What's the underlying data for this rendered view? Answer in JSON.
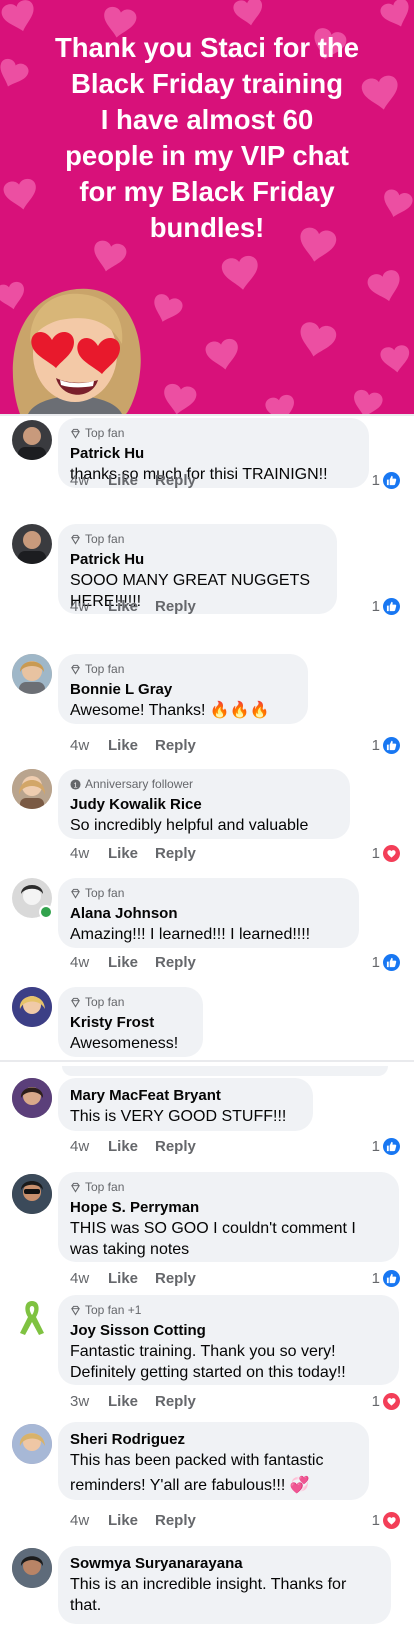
{
  "banner": {
    "lines": [
      "Thank you Staci for the",
      "Black Friday training",
      "I have almost 60",
      "people in my VIP chat",
      "for my Black Friday",
      "bundles!"
    ],
    "bg_color": "#d8117a"
  },
  "comments": [
    {
      "badge": "Top fan",
      "badge_icon": "diamond-icon",
      "name": "Patrick Hu",
      "text": [
        "thanks so much for thisi TRAINIGN!!"
      ],
      "time": "4w",
      "like": "Like",
      "reply": "Reply",
      "count": "1",
      "reaction": "like"
    },
    {
      "badge": "Top fan",
      "badge_icon": "diamond-icon",
      "name": "Patrick Hu",
      "text": [
        "SOOO MANY GREAT NUGGETS",
        "HERE!!!!!!"
      ],
      "time": "4w",
      "like": "Like",
      "reply": "Reply",
      "count": "1",
      "reaction": "like"
    },
    {
      "badge": "Top fan",
      "badge_icon": "diamond-icon",
      "name": "Bonnie L Gray",
      "text": [
        "Awesome!  Thanks! 🔥🔥🔥"
      ],
      "time": "4w",
      "like": "Like",
      "reply": "Reply",
      "count": "1",
      "reaction": "like"
    },
    {
      "badge": "Anniversary follower",
      "badge_icon": "anniversary-icon",
      "name": "Judy Kowalik Rice",
      "text": [
        "So incredibly helpful and valuable"
      ],
      "time": "4w",
      "like": "Like",
      "reply": "Reply",
      "count": "1",
      "reaction": "love"
    },
    {
      "badge": "Top fan",
      "badge_icon": "diamond-icon",
      "name": "Alana Johnson",
      "text": [
        "Amazing!!!  I learned!!!  I learned!!!!"
      ],
      "time": "4w",
      "like": "Like",
      "reply": "Reply",
      "count": "1",
      "reaction": "like"
    },
    {
      "badge": "Top fan",
      "badge_icon": "diamond-icon",
      "name": "Kristy Frost",
      "text": [
        "Awesomeness!"
      ],
      "time": "",
      "like": "",
      "reply": "",
      "count": "",
      "reaction": ""
    },
    {
      "badge": "",
      "badge_icon": "",
      "name": "Mary MacFeat Bryant",
      "text": [
        "This is VERY GOOD STUFF!!!"
      ],
      "time": "4w",
      "like": "Like",
      "reply": "Reply",
      "count": "1",
      "reaction": "like"
    },
    {
      "badge": "Top fan",
      "badge_icon": "diamond-icon",
      "name": "Hope S. Perryman",
      "text": [
        "THIS was SO GOO I couldn't comment I",
        "was taking notes"
      ],
      "time": "4w",
      "like": "Like",
      "reply": "Reply",
      "count": "1",
      "reaction": "like"
    },
    {
      "badge": "Top fan +1",
      "badge_icon": "diamond-icon",
      "name": "Joy Sisson Cotting",
      "text": [
        "Fantastic training. Thank you so very!",
        "Definitely getting started on this today!!"
      ],
      "time": "3w",
      "like": "Like",
      "reply": "Reply",
      "count": "1",
      "reaction": "love"
    },
    {
      "badge": "",
      "badge_icon": "",
      "name": "Sheri Rodriguez",
      "text": [
        "This has been packed with fantastic",
        "reminders!  Y'all are fabulous!!!  💞"
      ],
      "time": "4w",
      "like": "Like",
      "reply": "Reply",
      "count": "1",
      "reaction": "love"
    },
    {
      "badge": "",
      "badge_icon": "",
      "name": "Sowmya Suryanarayana",
      "text": [
        "This is an incredible insight. Thanks for",
        "that."
      ],
      "time": "",
      "like": "",
      "reply": "",
      "count": "",
      "reaction": ""
    }
  ]
}
